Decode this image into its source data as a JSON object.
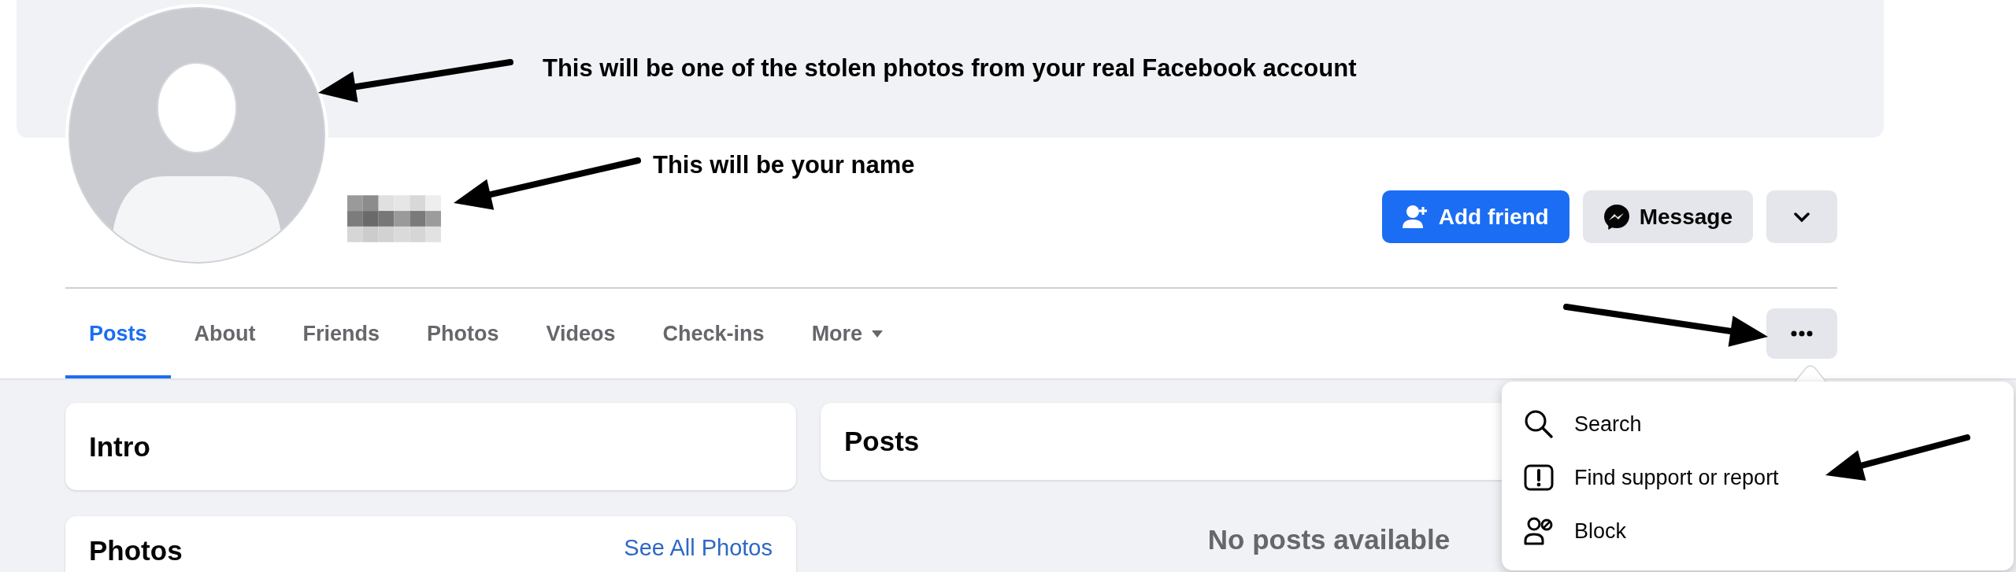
{
  "annotations": [
    {
      "text": "This will be one of the stolen photos from your real Facebook account"
    },
    {
      "text": "This will be your name"
    }
  ],
  "profile": {
    "buttons": [
      {
        "kind": "primary",
        "label": "Add friend"
      },
      {
        "kind": "secondary",
        "label": "Message"
      },
      {
        "kind": "dropdown"
      }
    ]
  },
  "tabs": [
    {
      "label": "Posts",
      "selected": true
    },
    {
      "label": "About",
      "selected": false
    },
    {
      "label": "Friends",
      "selected": false
    },
    {
      "label": "Photos",
      "selected": false
    },
    {
      "label": "Videos",
      "selected": false
    },
    {
      "label": "Check-ins",
      "selected": false
    },
    {
      "label": "More",
      "selected": false,
      "kind": "dropdown"
    }
  ],
  "menu": {
    "items": [
      {
        "kind": "search",
        "label": "Search"
      },
      {
        "kind": "report",
        "label": "Find support or report"
      },
      {
        "kind": "block",
        "label": "Block"
      }
    ]
  },
  "intro": {
    "title": "Intro"
  },
  "photos": {
    "title": "Photos",
    "link": "See All Photos"
  },
  "posts": {
    "title": "Posts",
    "empty_message": "No posts available"
  }
}
